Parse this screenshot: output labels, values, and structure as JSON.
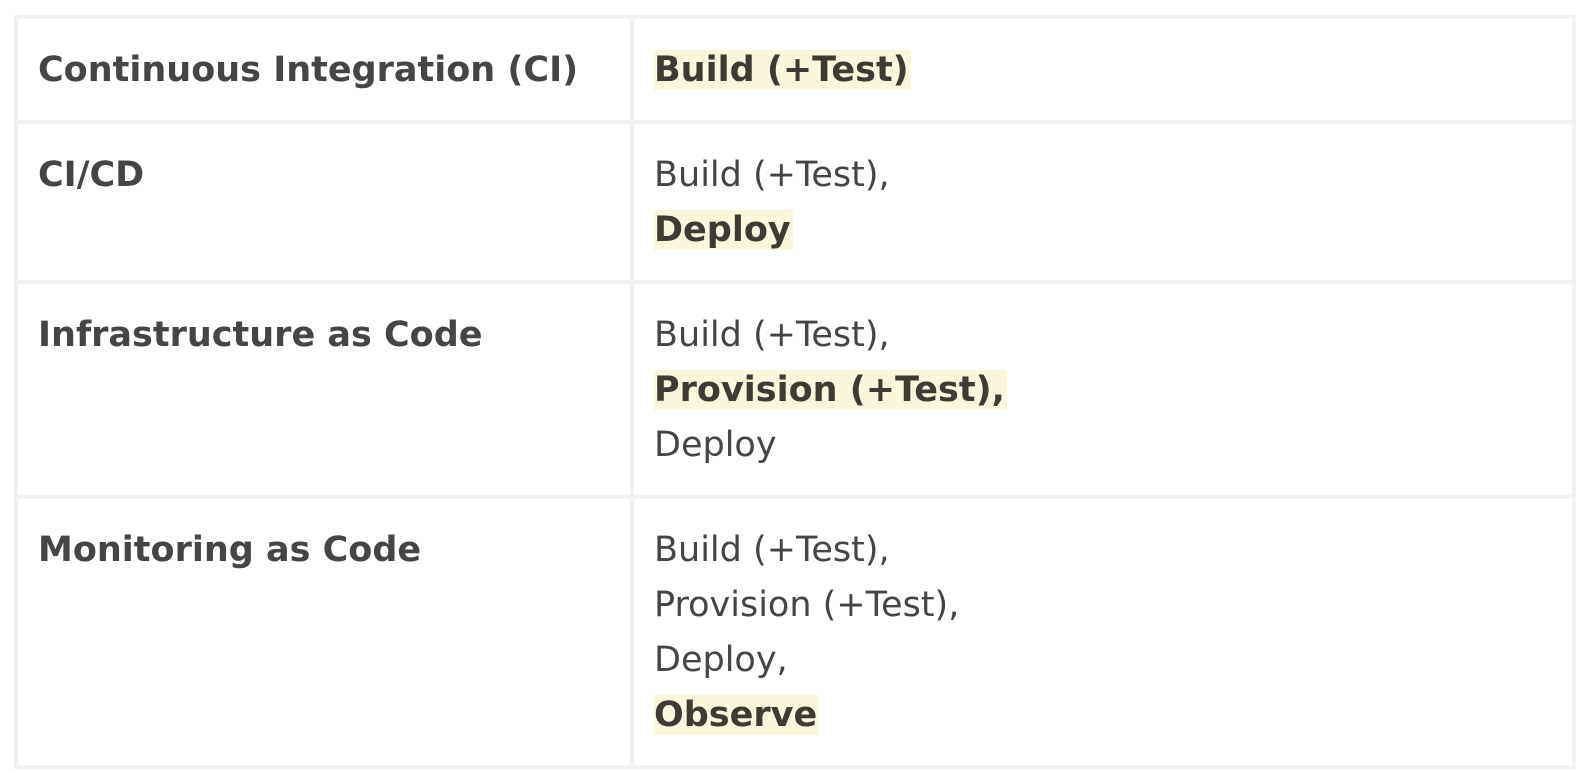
{
  "table": {
    "rows": [
      {
        "term": "Continuous Integration (CI)",
        "stages": [
          {
            "text": "Build (+Test)",
            "highlight": true
          }
        ]
      },
      {
        "term": "CI/CD",
        "stages": [
          {
            "text": "Build (+Test),",
            "highlight": false
          },
          {
            "text": "Deploy",
            "highlight": true
          }
        ]
      },
      {
        "term": "Infrastructure as Code",
        "stages": [
          {
            "text": "Build (+Test),",
            "highlight": false
          },
          {
            "text": "Provision (+Test),",
            "highlight": true
          },
          {
            "text": "Deploy",
            "highlight": false
          }
        ]
      },
      {
        "term": "Monitoring as Code",
        "stages": [
          {
            "text": "Build (+Test),",
            "highlight": false
          },
          {
            "text": "Provision (+Test),",
            "highlight": false
          },
          {
            "text": "Deploy,",
            "highlight": false
          },
          {
            "text": "Observe",
            "highlight": true
          }
        ]
      }
    ]
  },
  "colors": {
    "text": "#454545",
    "highlight_background": "#fbf6dc",
    "border": "#f2f2f2"
  }
}
